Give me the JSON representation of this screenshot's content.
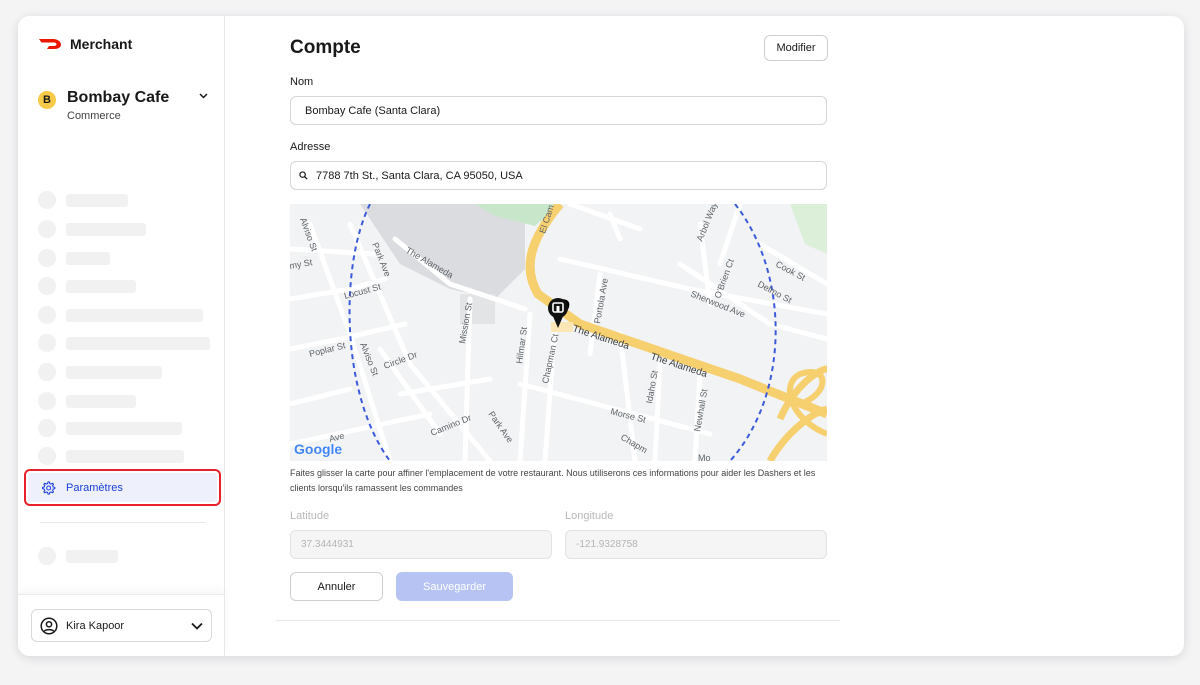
{
  "brand": {
    "name": "Merchant"
  },
  "store": {
    "badge": "B",
    "name": "Bombay Cafe",
    "type": "Commerce"
  },
  "sidebar": {
    "settings_label": "Paramètres"
  },
  "user": {
    "name": "Kira Kapoor"
  },
  "account": {
    "title": "Compte",
    "edit_label": "Modifier",
    "name_label": "Nom",
    "name_value": "Bombay Cafe (Santa Clara)",
    "address_label": "Adresse",
    "address_value": "7788 7th St., Santa Clara, CA 95050, USA",
    "map_note": "Faites glisser la carte pour affiner l'emplacement de votre restaurant. Nous utiliserons ces informations pour aider les Dashers et les clients lorsqu'ils ramassent les commandes",
    "latitude_label": "Latitude",
    "latitude_value": "37.3444931",
    "longitude_label": "Longitude",
    "longitude_value": "-121.9328758",
    "cancel_label": "Annuler",
    "save_label": "Sauvegarder"
  },
  "map": {
    "streets": [
      "El Cam",
      "Arbol Way",
      "Alviso St",
      "Park Ave",
      "The Alameda",
      "my St",
      "Locust St",
      "Mission St",
      "Portola Ave",
      "O'Brien Ct",
      "Cook St",
      "Delmo St",
      "Sherwood Ave",
      "Hilmar St",
      "Chapman Ct",
      "The Alameda",
      "The Alameda",
      "Poplar St",
      "Alviso St",
      "Circle Dr",
      "Idaho St",
      "Newhall St",
      "Morse St",
      "Camino Dr",
      "Park Ave",
      "Chapm",
      "Mo",
      "Ave"
    ],
    "attribution": "Google"
  },
  "colors": {
    "accent": "#1a3fd6",
    "highlight_border": "#e8202a",
    "brand_red": "#eb1700",
    "major_road": "#f6cf6f",
    "radius_line": "#3b5bdb"
  }
}
